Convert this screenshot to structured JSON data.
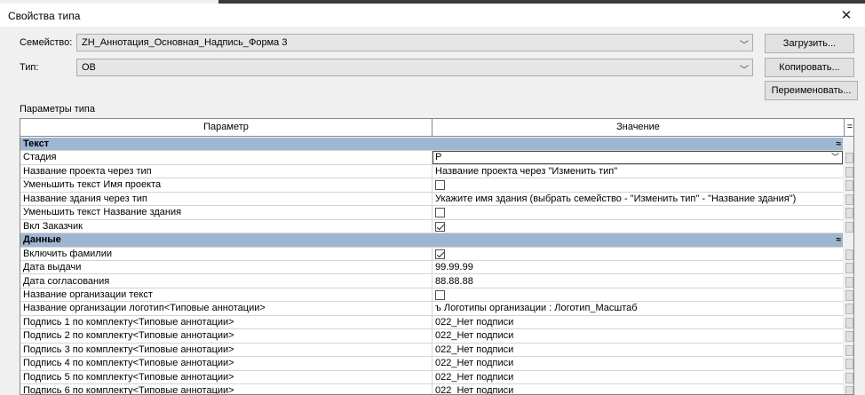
{
  "window": {
    "title": "Свойства типа",
    "close_glyph": "✕"
  },
  "family": {
    "label": "Семейство:",
    "value": "ZH_Аннотация_Основная_Надпись_Форма 3"
  },
  "type": {
    "label": "Тип:",
    "value": "ОВ"
  },
  "buttons": {
    "load": "Загрузить...",
    "copy": "Копировать...",
    "rename": "Переименовать..."
  },
  "params_label": "Параметры типа",
  "grid": {
    "col_param": "Параметр",
    "col_value": "Значение",
    "col_corner": "="
  },
  "rows": [
    {
      "kind": "group",
      "label": "Текст"
    },
    {
      "kind": "edit",
      "label": "Стадия",
      "value": "Р"
    },
    {
      "kind": "text",
      "label": "Название проекта через тип",
      "value": "Название проекта через \"Изменить тип\""
    },
    {
      "kind": "check",
      "label": "Уменьшить текст Имя проекта",
      "checked": false
    },
    {
      "kind": "text",
      "label": "Название здания через тип",
      "value": "Укажите имя здания (выбрать семейство - \"Изменить тип\" - \"Название здания\")"
    },
    {
      "kind": "check",
      "label": "Уменьшить текст Название здания",
      "checked": false
    },
    {
      "kind": "check",
      "label": "Вкл Заказчик",
      "checked": true
    },
    {
      "kind": "group",
      "label": "Данные"
    },
    {
      "kind": "check",
      "label": "Включить фамилии",
      "checked": true
    },
    {
      "kind": "text",
      "label": "Дата выдачи",
      "value": "99.99.99"
    },
    {
      "kind": "text",
      "label": "Дата согласования",
      "value": "88.88.88"
    },
    {
      "kind": "check",
      "label": "Название организации текст",
      "checked": false
    },
    {
      "kind": "text",
      "label": "Название организации логотип<Типовые аннотации>",
      "value": "ъ Логотипы организации : Логотип_Масштаб"
    },
    {
      "kind": "text",
      "label": "Подпись 1 по комплекту<Типовые аннотации>",
      "value": "022_Нет подписи"
    },
    {
      "kind": "text",
      "label": "Подпись 2 по комплекту<Типовые аннотации>",
      "value": "022_Нет подписи"
    },
    {
      "kind": "text",
      "label": "Подпись 3 по комплекту<Типовые аннотации>",
      "value": "022_Нет подписи"
    },
    {
      "kind": "text",
      "label": "Подпись 4 по комплекту<Типовые аннотации>",
      "value": "022_Нет подписи"
    },
    {
      "kind": "text",
      "label": "Подпись 5 по комплекту<Типовые аннотации>",
      "value": "022_Нет подписи"
    },
    {
      "kind": "text",
      "label": "Подпись 6 по комплекту<Типовые аннотации>",
      "value": "022_Нет подписи"
    }
  ],
  "colors": {
    "group_bg": "#9fb6d0",
    "dialog_bg": "#f0f0f0"
  }
}
